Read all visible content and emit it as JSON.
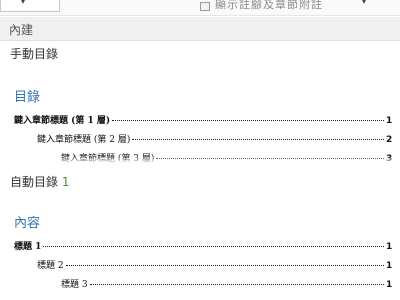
{
  "topbar": {
    "left_dropdown_arrow": "▾",
    "action_label": "顯示註腳及章節附註",
    "right_dropdown_arrow": "▾"
  },
  "section_header": "內建",
  "gallery": [
    {
      "title": "手動目錄",
      "title_suffix": "",
      "heading": "目錄",
      "entries": [
        {
          "label": "鍵入章節標題 (第 1 層)",
          "page": "1",
          "level": 1
        },
        {
          "label": "鍵入章節標題 (第 2 層)",
          "page": "2",
          "level": 2
        },
        {
          "label": "鍵入章節標題 (第 3 層)",
          "page": "3",
          "level": 3
        }
      ]
    },
    {
      "title": "自動目錄",
      "title_suffix": "1",
      "heading": "內容",
      "entries": [
        {
          "label": "標題 1",
          "page": "1",
          "level": 1
        },
        {
          "label": "標題 2",
          "page": "1",
          "level": 2
        },
        {
          "label": "標題 3",
          "page": "1",
          "level": 3
        }
      ]
    }
  ]
}
